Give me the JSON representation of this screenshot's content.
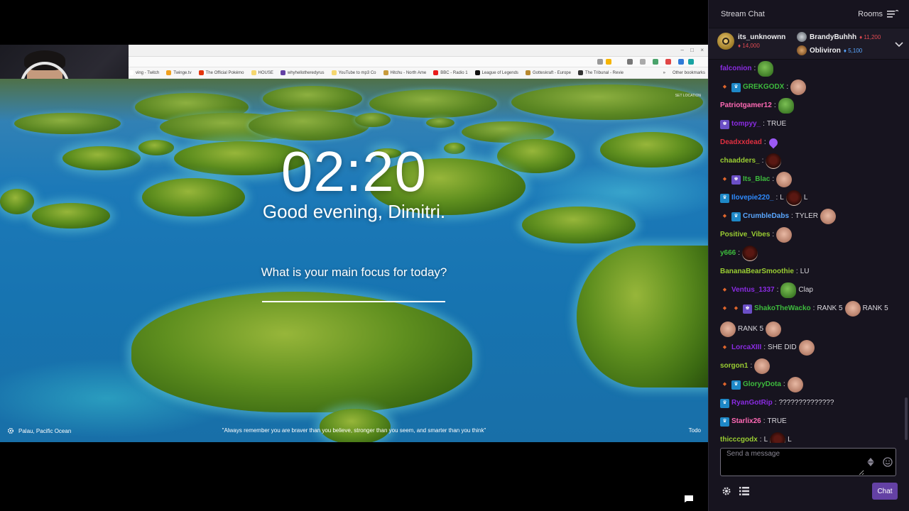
{
  "browser": {
    "bookmarks": [
      {
        "label": "ving - Twitch",
        "color": "#ffffff"
      },
      {
        "label": "Twinge.tv",
        "color": "#f0a01e"
      },
      {
        "label": "The Official Pokémo",
        "color": "#e3350d"
      },
      {
        "label": "HOUSE",
        "color": "#f5d76e"
      },
      {
        "label": "whyhellotheredyrus",
        "color": "#6441a4"
      },
      {
        "label": "YouTube to mp3 Co",
        "color": "#f5d76e"
      },
      {
        "label": "Hitchu - North Ame",
        "color": "#c89b3c"
      },
      {
        "label": "BBC - Radio 1",
        "color": "#e81c1c"
      },
      {
        "label": "League of Legends",
        "color": "#111111"
      },
      {
        "label": "Gotteskraft - Europe",
        "color": "#b8892f"
      },
      {
        "label": "The Tribunal - Revie",
        "color": "#333333"
      }
    ],
    "more_bookmarks": "»",
    "other_bookmarks": "Other bookmarks"
  },
  "dashboard": {
    "clock": "02:20",
    "greeting": "Good evening, Dimitri.",
    "focus_question": "What is your main focus for today?",
    "focus_value": "",
    "set_location": "SET LOCATION",
    "location": "Palau, Pacific Ocean",
    "quote": "\"Always remember you are braver than you believe, stronger than you seem, and smarter than you think\"",
    "todo": "Todo"
  },
  "chat": {
    "title": "Stream Chat",
    "rooms": "Rooms",
    "leaderboard": {
      "first": {
        "name": "its_unknownn",
        "score": "14,000"
      },
      "second": {
        "name": "BrandyBuhhh",
        "score": "11,200"
      },
      "third": {
        "name": "Obliviron",
        "score": "5,100"
      }
    },
    "messages": [
      {
        "badges": [],
        "user": "falconion",
        "color": "#8a2be2",
        "parts": [
          {
            "emote": "pepe"
          }
        ]
      },
      {
        "badges": [
          "bits",
          "crown"
        ],
        "user": "GREKGODX",
        "color": "#3dbb3d",
        "parts": [
          {
            "emote": "face"
          }
        ]
      },
      {
        "badges": [],
        "user": "Patriotgamer12",
        "color": "#ff69b4",
        "parts": [
          {
            "emote": "pepe"
          }
        ]
      },
      {
        "badges": [
          "prime"
        ],
        "user": "tompyy_",
        "color": "#8a2be2",
        "parts": [
          {
            "text": "TRUE"
          }
        ]
      },
      {
        "badges": [],
        "user": "Deadxxdead",
        "color": "#e03040",
        "parts": [
          {
            "emote": "heart"
          }
        ]
      },
      {
        "badges": [],
        "user": "chaadders_",
        "color": "#9acd32",
        "parts": [
          {
            "emote": "dark"
          }
        ]
      },
      {
        "badges": [
          "bits",
          "prime"
        ],
        "user": "Its_Blac",
        "color": "#3dbb3d",
        "parts": [
          {
            "emote": "face"
          }
        ]
      },
      {
        "badges": [
          "crown"
        ],
        "user": "Ilovepie220_",
        "color": "#2e8bff",
        "parts": [
          {
            "text": "L"
          },
          {
            "emote": "dark"
          },
          {
            "text": "L"
          }
        ]
      },
      {
        "badges": [
          "bits",
          "crown"
        ],
        "user": "CrumbleDabs",
        "color": "#5aa7ff",
        "parts": [
          {
            "text": "TYLER"
          },
          {
            "emote": "face"
          }
        ]
      },
      {
        "badges": [],
        "user": "Positive_Vibes",
        "color": "#9acd32",
        "parts": [
          {
            "emote": "face"
          }
        ]
      },
      {
        "badges": [],
        "user": "y666",
        "color": "#3dbb3d",
        "parts": [
          {
            "emote": "dark"
          }
        ]
      },
      {
        "badges": [],
        "user": "BananaBearSmoothie",
        "color": "#9acd32",
        "parts": [
          {
            "text": "LU"
          }
        ]
      },
      {
        "badges": [
          "bits"
        ],
        "user": "Ventus_1337",
        "color": "#8a2be2",
        "parts": [
          {
            "emote": "pepe"
          },
          {
            "text": "Clap"
          }
        ]
      },
      {
        "badges": [
          "bits",
          "bits",
          "prime"
        ],
        "user": "ShakoTheWacko",
        "color": "#3dbb3d",
        "parts": [
          {
            "text": "RANK 5"
          },
          {
            "emote": "face"
          },
          {
            "text": "RANK 5"
          },
          {
            "emote": "face"
          },
          {
            "text": "RANK 5"
          },
          {
            "emote": "face"
          }
        ]
      },
      {
        "badges": [
          "bits"
        ],
        "user": "LorcaXIII",
        "color": "#8a2be2",
        "parts": [
          {
            "text": "SHE DID"
          },
          {
            "emote": "face"
          }
        ]
      },
      {
        "badges": [],
        "user": "sorgon1",
        "color": "#9acd32",
        "parts": [
          {
            "emote": "face"
          }
        ]
      },
      {
        "badges": [
          "bits",
          "crown"
        ],
        "user": "GloryyDota",
        "color": "#3dbb3d",
        "parts": [
          {
            "emote": "face"
          }
        ]
      },
      {
        "badges": [
          "crown"
        ],
        "user": "RyanGotRip",
        "color": "#8a2be2",
        "parts": [
          {
            "text": "??????????????"
          }
        ]
      },
      {
        "badges": [
          "crown"
        ],
        "user": "Starlix26",
        "color": "#ff69b4",
        "parts": [
          {
            "text": "TRUE"
          }
        ]
      },
      {
        "badges": [],
        "user": "thicccgodx",
        "color": "#9acd32",
        "parts": [
          {
            "text": "L"
          },
          {
            "emote": "dark"
          },
          {
            "text": "L"
          }
        ]
      }
    ],
    "input_placeholder": "Send a message",
    "send_label": "Chat"
  },
  "colors": {
    "accent": "#6441a4",
    "chat_bg": "#17141f",
    "red_score": "#e24a52",
    "blue_score": "#5aa7ff"
  },
  "icons": [
    "settings-gear-icon",
    "viewer-list-icon",
    "emote-smiley-icon",
    "bits-icon",
    "rooms-menu-icon",
    "chevron-down-icon",
    "chat-bubble-icon",
    "location-gear-icon"
  ]
}
